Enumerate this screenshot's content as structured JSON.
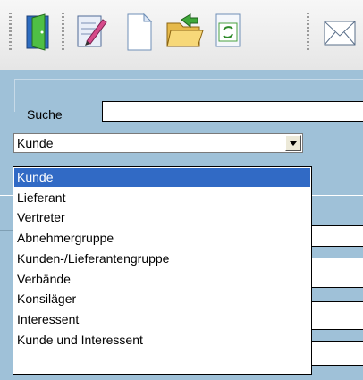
{
  "toolbar": {
    "buttons": [
      {
        "name": "exit-door-icon"
      },
      {
        "name": "edit-document-icon"
      },
      {
        "name": "new-document-icon"
      },
      {
        "name": "open-folder-icon"
      },
      {
        "name": "refresh-document-icon"
      },
      {
        "name": "envelope-icon"
      }
    ]
  },
  "search": {
    "label": "Suche",
    "value": ""
  },
  "type_select": {
    "selected": "Kunde",
    "options": [
      "Kunde",
      "Lieferant",
      "Vertreter",
      "Abnehmergruppe",
      "Kunden-/Lieferantengruppe",
      "Verbände",
      "Konsiläger",
      "Interessent",
      "Kunde und Interessent"
    ],
    "highlighted_index": 0
  },
  "colors": {
    "panel": "#9fc1d8",
    "selection": "#316ac5"
  }
}
